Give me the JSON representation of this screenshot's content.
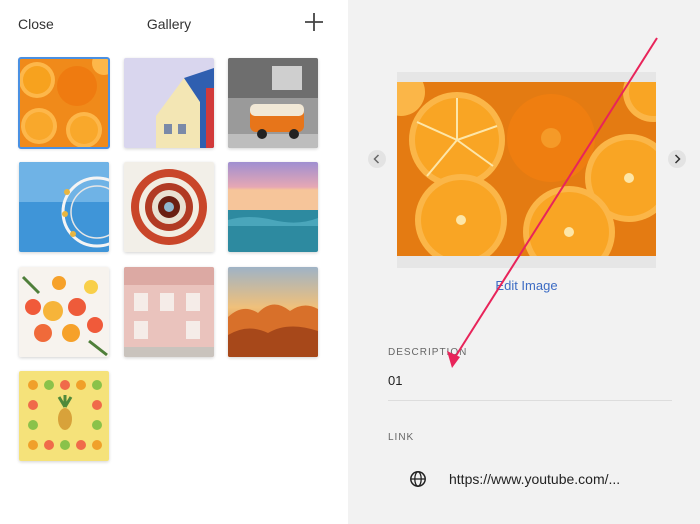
{
  "header": {
    "close_label": "Close",
    "title": "Gallery",
    "add_icon": "plus-icon"
  },
  "gallery": {
    "items": [
      {
        "name": "orange-slices",
        "selected": true
      },
      {
        "name": "colorful-houses"
      },
      {
        "name": "orange-van"
      },
      {
        "name": "ferris-wheel"
      },
      {
        "name": "spiral-staircase"
      },
      {
        "name": "ocean-sunset"
      },
      {
        "name": "citrus-flatlay"
      },
      {
        "name": "pink-building"
      },
      {
        "name": "clouds-sunset"
      },
      {
        "name": "fruit-yellow-bg"
      }
    ]
  },
  "detail": {
    "edit_image_label": "Edit Image",
    "description_label": "DESCRIPTION",
    "description_value": "01",
    "link_label": "LINK",
    "link_value": "https://www.youtube.com/...",
    "link_icon": "globe-icon",
    "prev_icon": "chevron-left-icon",
    "next_icon": "chevron-right-icon"
  },
  "colors": {
    "accent": "#3d6cc4",
    "selection": "#4a90e2",
    "annotation_arrow": "#e8245a",
    "panel_bg": "#f2f2f2"
  }
}
